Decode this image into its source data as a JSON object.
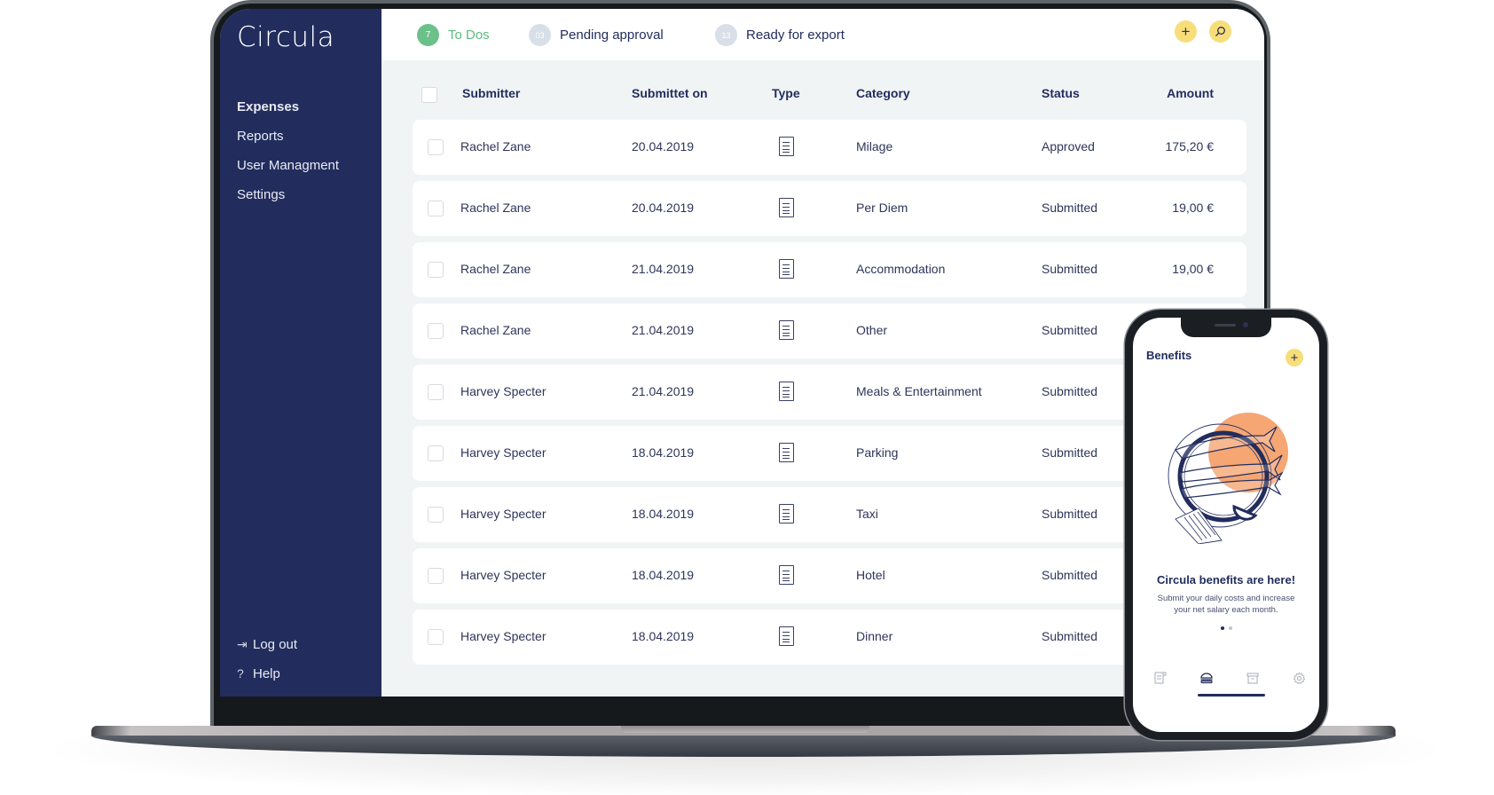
{
  "app": {
    "brand": "Circula",
    "sidebar": {
      "items": [
        {
          "label": "Expenses",
          "active": true
        },
        {
          "label": "Reports",
          "active": false
        },
        {
          "label": "User Managment",
          "active": false
        },
        {
          "label": "Settings",
          "active": false
        }
      ],
      "bottom": [
        {
          "label": "Log out",
          "icon": "logout-icon",
          "glyph": "⇥"
        },
        {
          "label": "Help",
          "icon": "help-icon",
          "glyph": "?"
        }
      ]
    },
    "header": {
      "tabs": [
        {
          "label": "To Dos",
          "count": "7",
          "active": true
        },
        {
          "label": "Pending approval",
          "count": "03",
          "active": false
        },
        {
          "label": "Ready for export",
          "count": "13",
          "active": false
        }
      ],
      "add_glyph": "+",
      "search_glyph": "⌕"
    },
    "table": {
      "columns": [
        "Submitter",
        "Submittet on",
        "Type",
        "Category",
        "Status",
        "Amount"
      ],
      "rows": [
        {
          "submitter": "Rachel Zane",
          "date": "20.04.2019",
          "type": "receipt",
          "category": "Milage",
          "status": "Approved",
          "amount": "175,20 €"
        },
        {
          "submitter": "Rachel Zane",
          "date": "20.04.2019",
          "type": "receipt",
          "category": "Per Diem",
          "status": "Submitted",
          "amount": "19,00 €"
        },
        {
          "submitter": "Rachel Zane",
          "date": "21.04.2019",
          "type": "receipt",
          "category": "Accommodation",
          "status": "Submitted",
          "amount": "19,00 €"
        },
        {
          "submitter": "Rachel Zane",
          "date": "21.04.2019",
          "type": "receipt",
          "category": "Other",
          "status": "Submitted",
          "amount": ""
        },
        {
          "submitter": "Harvey Specter",
          "date": "21.04.2019",
          "type": "receipt",
          "category": "Meals & Entertainment",
          "status": "Submitted",
          "amount": ""
        },
        {
          "submitter": "Harvey Specter",
          "date": "18.04.2019",
          "type": "receipt",
          "category": "Parking",
          "status": "Submitted",
          "amount": ""
        },
        {
          "submitter": "Harvey Specter",
          "date": "18.04.2019",
          "type": "receipt",
          "category": "Taxi",
          "status": "Submitted",
          "amount": ""
        },
        {
          "submitter": "Harvey Specter",
          "date": "18.04.2019",
          "type": "receipt",
          "category": "Hotel",
          "status": "Submitted",
          "amount": ""
        },
        {
          "submitter": "Harvey Specter",
          "date": "18.04.2019",
          "type": "receipt",
          "category": "Dinner",
          "status": "Submitted",
          "amount": ""
        }
      ]
    }
  },
  "phone": {
    "title": "Benefits",
    "add_glyph": "+",
    "headline": "Circula benefits are here!",
    "body": "Submit your daily costs and increase your net salary each month.",
    "carousel": {
      "pages": 2,
      "current": 1
    },
    "tabbar": [
      "expenses-tab",
      "benefits-tab",
      "archive-tab",
      "settings-tab"
    ],
    "active_tab": 1
  },
  "colors": {
    "sidebar": "#222d5e",
    "accent_green": "#6cc08a",
    "accent_yellow": "#f7de7b",
    "illustration_orange": "#f5a673",
    "text_dark": "#222d5e"
  }
}
